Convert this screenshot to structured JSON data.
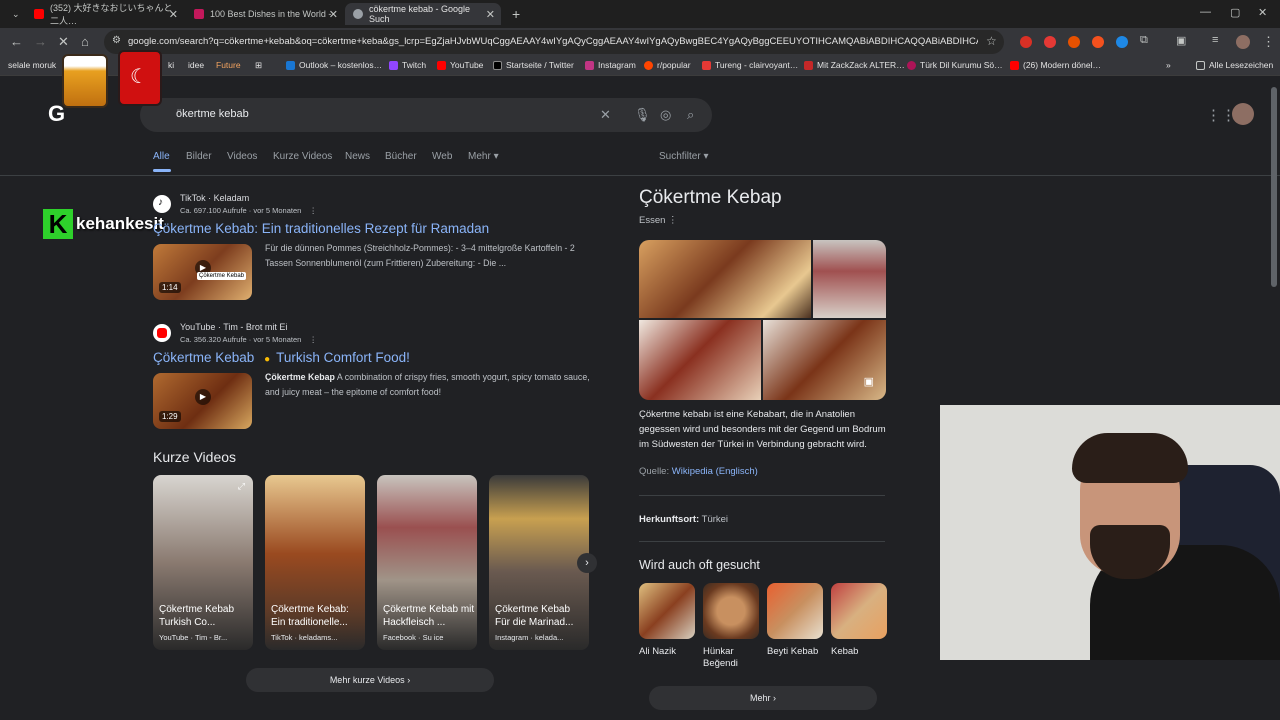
{
  "browser": {
    "tabs": [
      {
        "title": "(352) 大好きなおじいちゃんと二人…",
        "favicon_color": "#ff0000"
      },
      {
        "title": "100 Best Dishes in the World -",
        "favicon_color": "#c2185b"
      },
      {
        "title": "cökertme kebab - Google Such",
        "favicon_color": "#9aa0a6"
      }
    ],
    "new_tab": "+",
    "url": "google.com/search?q=cökertme+kebab&oq=cökertme+keba&gs_lcrp=EgZjaHJvbWUqCggAEAAY4wIYgAQyCggAEAAY4wIYgAQyBwgBEC4YgAQyBggCEEUYOTIHCAMQABiABDIHCAQQABiABDIHCAUQABiA…",
    "bookmarks": [
      "selale moruk",
      "ki",
      "idee",
      "Future",
      "Outlook – kostenlos…",
      "Twitch",
      "YouTube",
      "Startseite / Twitter",
      "Instagram",
      "r/popular",
      "Tureng - clairvoyant…",
      "Mit ZackZack ALTER…",
      "Türk Dil Kurumu Sö…",
      "(26) Modern dönel…"
    ],
    "bookmarks_more": "»",
    "all_bookmarks": "Alle Lesezeichen"
  },
  "overlay": {
    "logo_letter": "K",
    "logo_text": "kehankesit"
  },
  "google": {
    "logo_fragment": "G",
    "query": "ökertme kebab",
    "filters": [
      "Alle",
      "Bilder",
      "Videos",
      "Kurze Videos",
      "News",
      "Bücher",
      "Web",
      "Mehr"
    ],
    "search_filter": "Suchfilter",
    "results": [
      {
        "source": "TikTok · Keladam",
        "meta": "Ca. 697.100 Aufrufe · vor 5 Monaten",
        "title": "Çökertme Kebab: Ein traditionelles Rezept für Ramadan",
        "snippet": "Für die dünnen Pommes (Streichholz-Pommes): - 3–4 mittelgroße Kartoffeln - 2 Tassen Sonnenblumenöl (zum Frittieren) Zubereitung: - Die ...",
        "duration": "1:14",
        "thumb_label": "Çökertme Kebab"
      },
      {
        "source": "YouTube · Tim - Brot mit Ei",
        "meta": "Ca. 356.320 Aufrufe · vor 5 Monaten",
        "title": "Çökertme Kebab",
        "title_suffix": "Turkish Comfort Food!",
        "snippet_bold": "Çökertme Kebap",
        "snippet": " A combination of crispy fries, smooth yogurt, spicy tomato sauce, and juicy meat – the epitome of comfort food!",
        "duration": "1:29"
      }
    ],
    "short_videos_heading": "Kurze Videos",
    "short_videos": [
      {
        "caption": "Çökertme Kebab Turkish Co...",
        "source": "YouTube · Tim - Br..."
      },
      {
        "caption": "Çökertme Kebab: Ein traditionelle...",
        "source": "TikTok · keladams..."
      },
      {
        "caption": "Çökertme Kebab mit Hackfleisch ...",
        "source": "Facebook · Su ice"
      },
      {
        "caption": "Çökertme Kebab Für die Marinad...",
        "source": "Instagram · kelada..."
      }
    ],
    "more_short_videos": "Mehr kurze Videos",
    "knowledge_panel": {
      "title": "Çökertme Kebap",
      "subtitle": "Essen",
      "description": "Çökertme kebabı ist eine Kebabart, die in Anatolien gegessen wird und besonders mit der Gegend um Bodrum im Südwesten der Türkei in Verbindung gebracht wird.",
      "source_label": "Quelle: ",
      "source_link": "Wikipedia (Englisch)",
      "origin_label": "Herkunftsort:",
      "origin_value": "Türkei",
      "related_heading": "Wird auch oft gesucht",
      "related": [
        "Ali Nazik",
        "Hünkar Beğendi",
        "Beyti Kebab",
        "Kebab"
      ],
      "more": "Mehr"
    }
  }
}
